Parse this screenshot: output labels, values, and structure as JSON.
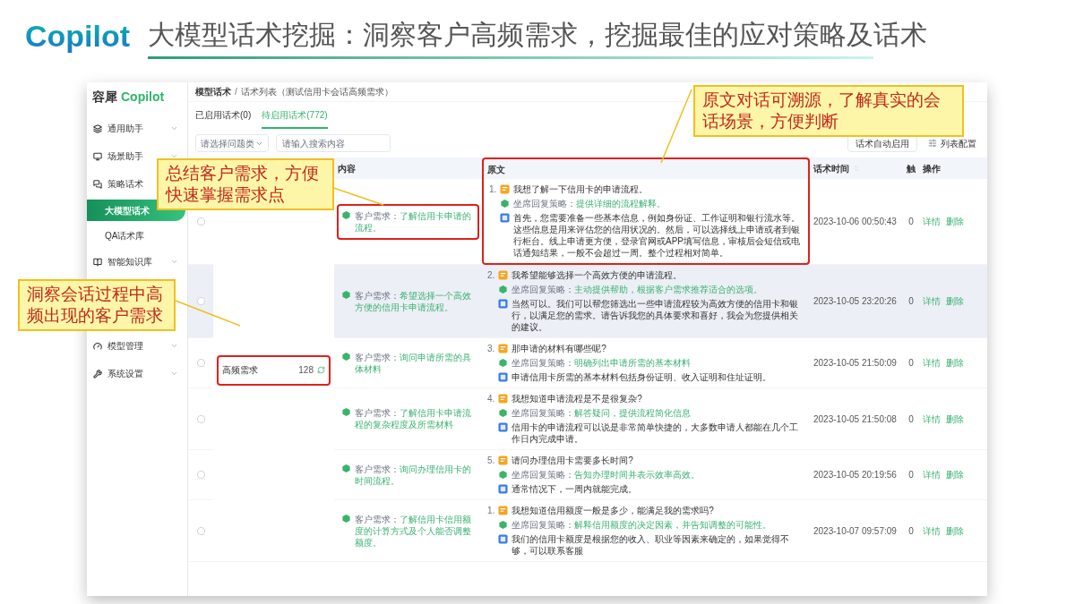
{
  "slide": {
    "logo": "Copilot",
    "title": "大模型话术挖掘：洞察客户高频需求，挖掘最佳的应对策略及话术"
  },
  "app": {
    "brand": {
      "name": "容犀",
      "suffix": "Copilot"
    },
    "sidebar": {
      "items": [
        {
          "label": "通用助手",
          "expanded": false
        },
        {
          "label": "场景助手",
          "expanded": false
        },
        {
          "label": "策略话术",
          "expanded": true,
          "children": [
            {
              "label": "大模型话术",
              "selected": true
            },
            {
              "label": "QA话术库",
              "selected": false
            }
          ]
        },
        {
          "label": "智能知识库",
          "expanded": false
        },
        {
          "label": "模型管理",
          "expanded": false
        },
        {
          "label": "系统设置",
          "expanded": false
        }
      ]
    },
    "breadcrumb": [
      "模型话术",
      "话术列表（测试信用卡会话高频需求）"
    ],
    "breadcrumb_separator": "/",
    "tabs": [
      {
        "label": "已启用话术(0)",
        "selected": false
      },
      {
        "label": "待启用话术(772)",
        "selected": true
      }
    ],
    "filters": {
      "type_select": {
        "placeholder": "请选择问题类"
      },
      "search": {
        "placeholder": "请输入搜索内容"
      }
    },
    "toolbar": {
      "auto_enable_button": "话术自动启用",
      "column_config_button": "列表配置"
    },
    "columns": [
      {
        "label": "内容",
        "highlighted": false
      },
      {
        "label": "原文",
        "highlighted": true
      },
      {
        "label": "话术时间",
        "highlighted": false
      },
      {
        "label": "触",
        "highlighted": false
      },
      {
        "label": "操作",
        "highlighted": false
      }
    ],
    "group": {
      "name": "高频需求",
      "count": "128",
      "highlighted": true
    },
    "rows": [
      {
        "checked": false,
        "hovered": false,
        "need_label": "客户需求：",
        "need": "了解信用卡申请的流程。",
        "need_highlighted": true,
        "index": "1.",
        "question": "我想了解一下信用卡的申请流程。",
        "strategy_label": "坐席回复策略：",
        "strategy": "提供详细的流程解释。",
        "answer": "首先，您需要准备一些基本信息，例如身份证、工作证明和银行流水等。这些信息是用来评估您的信用状况的。然后，可以选择线上申请或者到银行柜台。线上申请更方便，登录官网或APP填写信息，审核后会短信或电话通知结果，一般不会超过一周。整个过程相对简单。",
        "time": "2023-10-06 00:50:43",
        "hits": "0",
        "actions": [
          "详情",
          "删除"
        ]
      },
      {
        "checked": false,
        "hovered": true,
        "need_label": "客户需求：",
        "need": "希望选择一个高效方便的信用卡申请流程。",
        "need_highlighted": false,
        "index": "2.",
        "question": "我希望能够选择一个高效方便的申请流程。",
        "strategy_label": "坐席回复策略：",
        "strategy": "主动提供帮助，根据客户需求推荐适合的选项。",
        "answer": "当然可以。我们可以帮您筛选出一些申请流程较为高效方便的信用卡和银行，以满足您的需求。请告诉我您的具体要求和喜好，我会为您提供相关的建议。",
        "time": "2023-10-05 23:20:26",
        "hits": "0",
        "actions": [
          "详情",
          "删除"
        ]
      },
      {
        "checked": false,
        "hovered": false,
        "need_label": "客户需求：",
        "need": "询问申请所需的具体材料",
        "need_highlighted": false,
        "index": "3.",
        "question": "那申请的材料有哪些呢?",
        "strategy_label": "坐席回复策略：",
        "strategy": "明确列出申请所需的基本材料",
        "answer": "申请信用卡所需的基本材料包括身份证明、收入证明和住址证明。",
        "time": "2023-10-05 21:50:09",
        "hits": "0",
        "actions": [
          "详情",
          "删除"
        ]
      },
      {
        "checked": false,
        "hovered": false,
        "need_label": "客户需求：",
        "need": "了解信用卡申请流程的复杂程度及所需材料",
        "need_highlighted": false,
        "index": "4.",
        "question": "我想知道申请流程是不是很复杂?",
        "strategy_label": "坐席回复策略：",
        "strategy": "解答疑问，提供流程简化信息",
        "answer": "信用卡的申请流程可以说是非常简单快捷的，大多数申请人都能在几个工作日内完成申请。",
        "time": "2023-10-05 21:50:08",
        "hits": "0",
        "actions": [
          "详情",
          "删除"
        ]
      },
      {
        "checked": false,
        "hovered": false,
        "need_label": "客户需求：",
        "need": "询问办理信用卡的时间流程。",
        "need_highlighted": false,
        "index": "5.",
        "question": "请问办理信用卡需要多长时间?",
        "strategy_label": "坐席回复策略：",
        "strategy": "告知办理时间并表示效率高效。",
        "answer": "通常情况下，一周内就能完成。",
        "time": "2023-10-05 20:19:56",
        "hits": "0",
        "actions": [
          "详情",
          "删除"
        ]
      },
      {
        "checked": false,
        "hovered": false,
        "need_label": "客户需求：",
        "need": "了解信用卡信用额度的计算方式及个人能否调整额度。",
        "need_highlighted": false,
        "index": "1.",
        "question": "我想知道信用额度一般是多少，能满足我的需求吗?",
        "strategy_label": "坐席回复策略：",
        "strategy": "解释信用额度的决定因素，并告知调整的可能性。",
        "answer": "我们的信用卡额度是根据您的收入、职业等因素来确定的，如果觉得不够，可以联系客服",
        "time": "2023-10-07 09:57:09",
        "hits": "0",
        "actions": [
          "详情",
          "删除"
        ]
      }
    ]
  },
  "callouts": [
    {
      "text": "总结客户需求，方便快速掌握需求点"
    },
    {
      "text": "洞察会话过程中高频出现的客户需求"
    },
    {
      "text": "原文对话可溯源，了解真实的会话场景，方便判断"
    }
  ]
}
